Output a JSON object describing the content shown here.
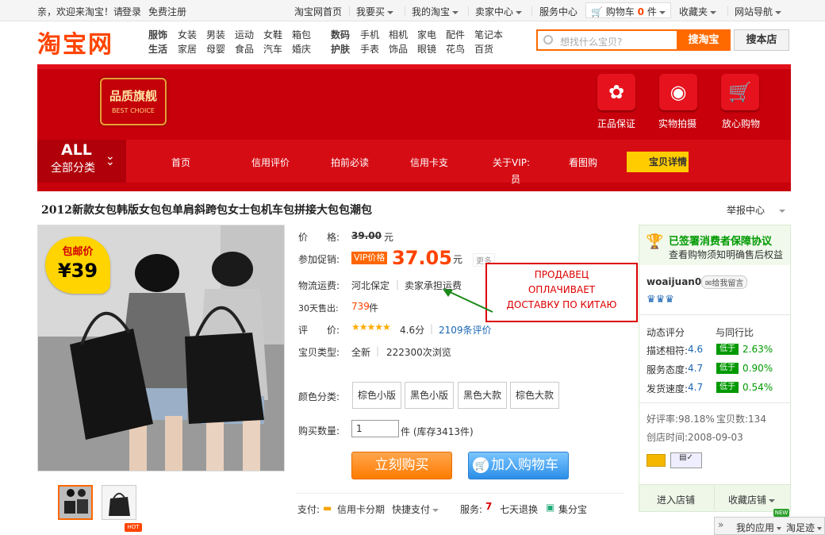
{
  "topbar": {
    "welcome": "亲，欢迎来淘宝！请",
    "login": "登录",
    "register": "免费注册",
    "links": [
      "淘宝网首页",
      "我要买",
      "我的淘宝",
      "卖家中心",
      "服务中心",
      "购物车",
      "收藏夹",
      "网站导航"
    ],
    "cart_count": "0",
    "cart_unit": "件"
  },
  "header": {
    "logo": "淘宝网",
    "categories": {
      "row1_bold": [
        "服饰",
        "数码"
      ],
      "row2_bold": [
        "生活",
        "护肤"
      ],
      "row1": [
        "女装",
        "男装",
        "运动",
        "女鞋",
        "箱包",
        "手机",
        "相机",
        "家电",
        "配件",
        "笔记本"
      ],
      "row2": [
        "家居",
        "母婴",
        "食品",
        "汽车",
        "婚庆",
        "手表",
        "饰品",
        "眼镜",
        "花鸟",
        "百货"
      ]
    },
    "search_placeholder": "想找什么宝贝?",
    "search_taobao": "搜淘宝",
    "search_shop": "搜本店"
  },
  "banner": {
    "badge_title": "品质旗舰",
    "badge_sub": "BEST CHOICE",
    "features": [
      "正品保证",
      "实物拍摄",
      "放心购物"
    ],
    "all_title": "ALL",
    "all_sub": "全部分类",
    "nav": [
      "首页",
      "信用评价",
      "拍前必读",
      "信用卡支",
      "关于VIP:",
      "员",
      "看图购",
      "宝贝详情"
    ]
  },
  "product": {
    "title": "2012新款女包韩版女包包单肩斜跨包女士包机车包拼接大包包潮包",
    "report": "举报中心",
    "stamp_top": "包邮价",
    "stamp_price": "¥39",
    "hot_tag": "HOT",
    "labels": {
      "price": "价　　格:",
      "promo": "参加促销:",
      "shipping": "物流运费:",
      "sold": "30天售出:",
      "rating": "评　　价:",
      "type": "宝贝类型:",
      "color": "颜色分类:",
      "qty": "购买数量:"
    },
    "orig_price": "39.00",
    "yuan": "元",
    "vip_tag": "VIP价格",
    "vip_price": "37.05",
    "more": "更多",
    "ship_from": "河北保定",
    "ship_fee": "卖家承担运费",
    "sold_count": "739",
    "sold_unit": "件",
    "rating_value": "4.6分",
    "review_count": "2109条评价",
    "condition": "全新",
    "views": "222300次浏览",
    "colors": [
      "棕色小版",
      "黑色小版",
      "黑色大款",
      "棕色大款"
    ],
    "qty_value": "1",
    "stock": "件 (库存3413件)",
    "buy_now": "立刻购买",
    "add_cart": "加入购物车",
    "pay_label": "支付:",
    "pay_credit": "信用卡分期",
    "pay_fast": "快捷支付",
    "service_label": "服务:",
    "service_return": "七天退换",
    "service_jfb": "集分宝"
  },
  "annotation": {
    "line1": "ПРОДАВЕЦ",
    "line2": "ОПЛАЧИВАЕТ",
    "line3": "ДОСТАВКУ ПО КИТАЮ"
  },
  "seller": {
    "protect_title": "已签署消费者保障协议",
    "protect_sub": "查看购物须知明确售后权益",
    "protect_link": "购物须知",
    "name": "woaijuan0",
    "message": "给我留言",
    "dynamic": "动态评分",
    "compare": "与同行比",
    "metrics": [
      {
        "label": "描述相符:",
        "score": "4.6",
        "tag": "低于",
        "pct": "2.63%"
      },
      {
        "label": "服务态度:",
        "score": "4.7",
        "tag": "低于",
        "pct": "0.90%"
      },
      {
        "label": "发货速度:",
        "score": "4.7",
        "tag": "低于",
        "pct": "0.54%"
      }
    ],
    "good_rate": "好评率:98.18%",
    "items": "宝贝数:134",
    "created": "创店时间:2008-09-03",
    "enter_shop": "进入店铺",
    "fav_shop": "收藏店铺"
  },
  "footer": {
    "new_tag": "NEW",
    "my_apps": "我的应用",
    "footprints": "淘足迹"
  }
}
